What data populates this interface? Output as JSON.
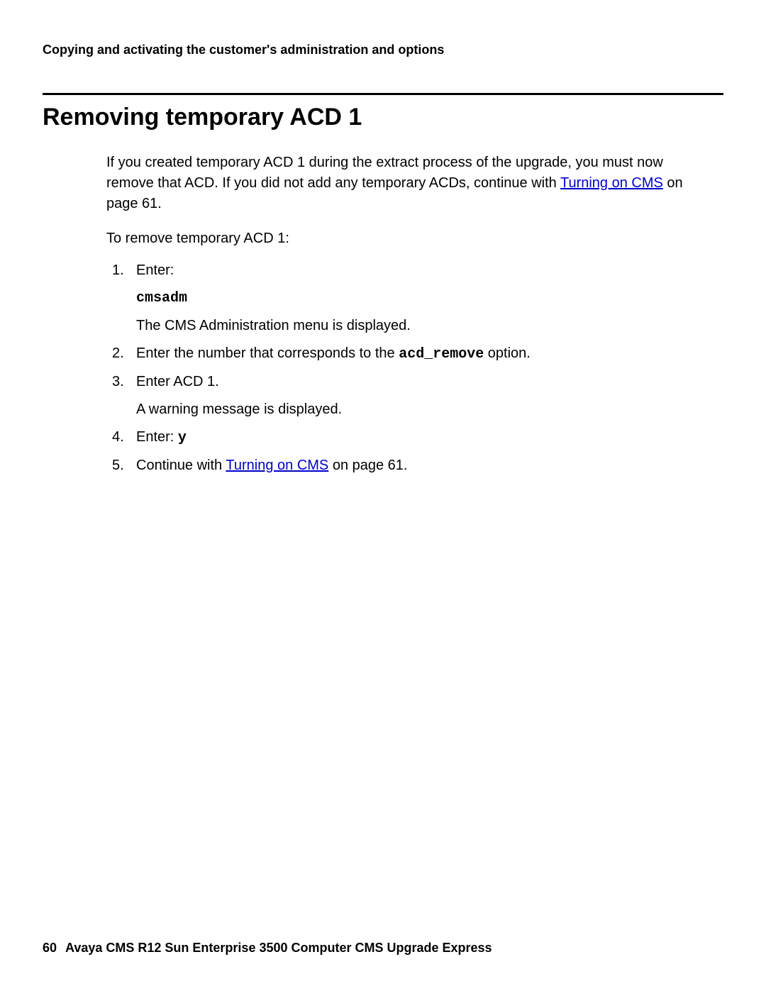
{
  "header": {
    "running": "Copying and activating the customer's administration and options"
  },
  "section": {
    "title": "Removing temporary ACD 1",
    "intro_pre": "If you created temporary ACD 1 during the extract process of the upgrade, you must now remove that ACD. If you did not add any temporary ACDs, continue with ",
    "intro_link": "Turning on CMS",
    "intro_post": " on page 61.",
    "lead": "To remove temporary ACD 1:",
    "steps": {
      "s1": {
        "num": "1.",
        "text": "Enter:",
        "cmd": "cmsadm",
        "result": "The CMS Administration menu is displayed."
      },
      "s2": {
        "num": "2.",
        "pre": "Enter the number that corresponds to the ",
        "code": "acd_remove",
        "post": " option."
      },
      "s3": {
        "num": "3.",
        "text": "Enter ACD 1.",
        "result": "A warning message is displayed."
      },
      "s4": {
        "num": "4.",
        "pre": "Enter: ",
        "code": "y"
      },
      "s5": {
        "num": "5.",
        "pre": "Continue with ",
        "link": "Turning on CMS",
        "post": " on page 61."
      }
    }
  },
  "footer": {
    "page": "60",
    "title": "Avaya CMS R12 Sun Enterprise 3500 Computer CMS Upgrade Express"
  }
}
